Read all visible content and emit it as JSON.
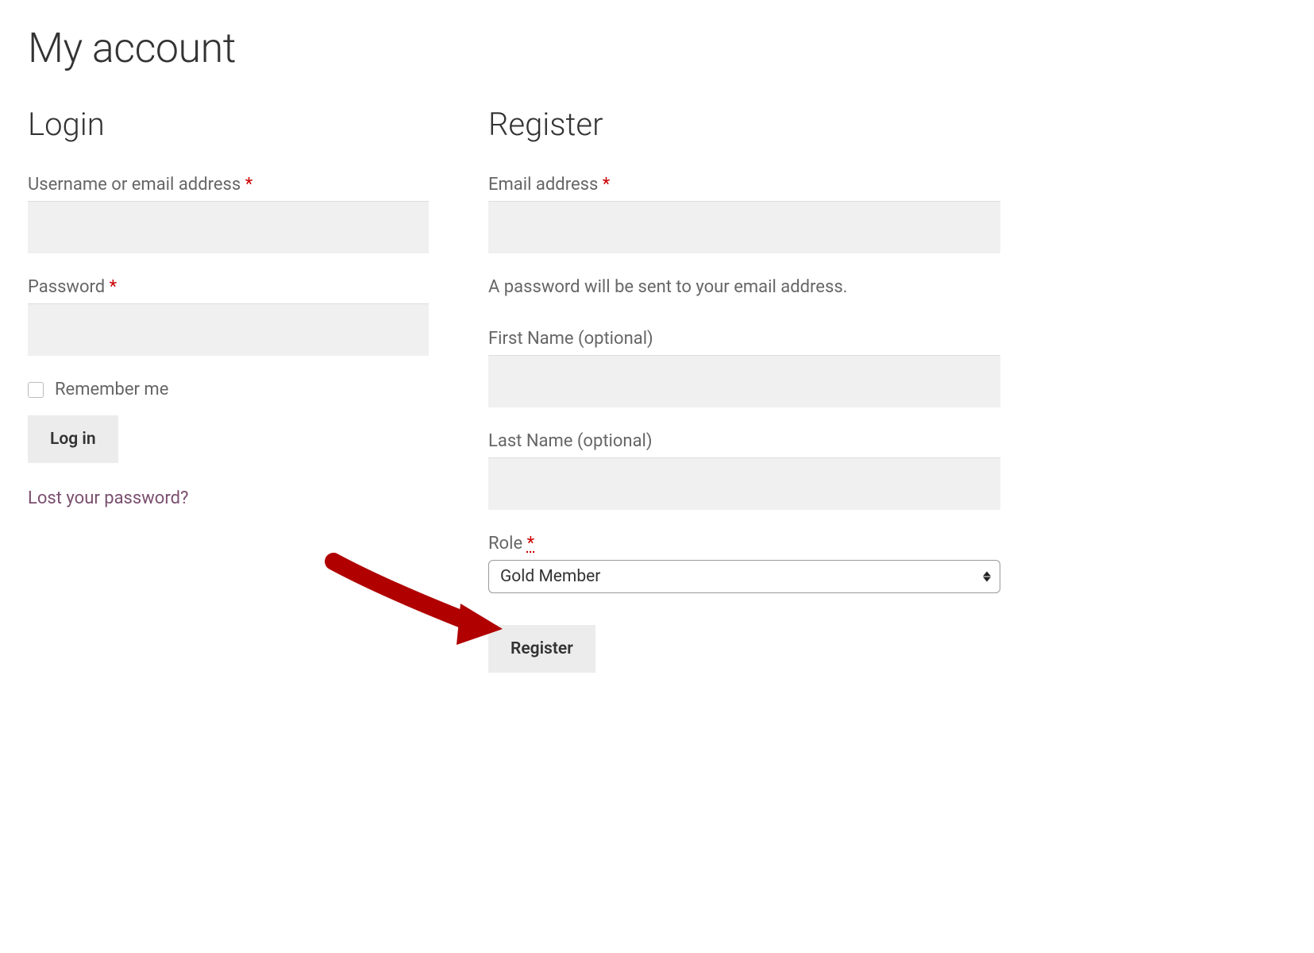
{
  "page": {
    "title": "My account"
  },
  "login": {
    "heading": "Login",
    "username_label": "Username or email address ",
    "password_label": "Password ",
    "remember_label": "Remember me",
    "submit_label": "Log in",
    "lost_password_label": "Lost your password?"
  },
  "register": {
    "heading": "Register",
    "email_label": "Email address ",
    "password_hint": "A password will be sent to your email address.",
    "first_name_label": "First Name (optional)",
    "last_name_label": "Last Name (optional)",
    "role_label": "Role ",
    "role_selected": "Gold Member",
    "submit_label": "Register"
  },
  "required_marker": "*"
}
